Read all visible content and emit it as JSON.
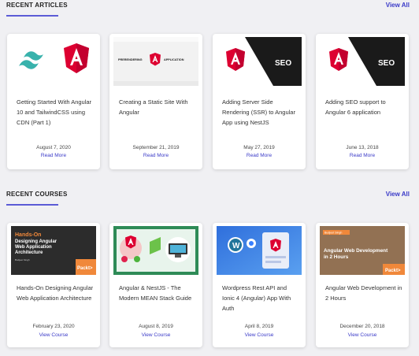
{
  "articles": {
    "title": "RECENT ARTICLES",
    "view_all": "View All",
    "items": [
      {
        "title": "Getting Started With Angular 10 and TailwindCSS using CDN (Part 1)",
        "date": "August 7, 2020",
        "link": "Read More"
      },
      {
        "title": "Creating a Static Site With Angular",
        "date": "September 21, 2019",
        "link": "Read More",
        "thumb_text": [
          "PRERENDERING",
          "APPLICATION"
        ]
      },
      {
        "title": "Adding Server Side Rendering (SSR) to Angular App using NestJS",
        "date": "May 27, 2019",
        "link": "Read More",
        "thumb_text": "SEO"
      },
      {
        "title": "Adding SEO support to Angular 6 application",
        "date": "June 13, 2018",
        "link": "Read More",
        "thumb_text": "SEO"
      }
    ]
  },
  "courses": {
    "title": "RECENT COURSES",
    "view_all": "View All",
    "items": [
      {
        "title": "Hands-On Designing Angular Web Application Architecture",
        "date": "February 23, 2020",
        "link": "View Course",
        "thumb_text": [
          "Hands-On",
          "Designing Angular",
          "Web Application",
          "Architecture",
          "Budjeet Singh",
          "Packt>"
        ]
      },
      {
        "title": "Angular & NestJS - The Modern MEAN Stack Guide",
        "date": "August 8, 2019",
        "link": "View Course"
      },
      {
        "title": "Wordpress Rest API and Ionic 4 (Angular) App With Auth",
        "date": "April 8, 2019",
        "link": "View Course"
      },
      {
        "title": "Angular Web Development in 2 Hours",
        "date": "December 20, 2018",
        "link": "View Course",
        "thumb_text": [
          "Budjeet Singh",
          "Angular Web Development",
          "in 2 Hours",
          "Packt>"
        ]
      }
    ]
  },
  "colors": {
    "accent": "#3a3ac8",
    "angular_red": "#dd0031",
    "tailwind_teal": "#38b2ac"
  }
}
